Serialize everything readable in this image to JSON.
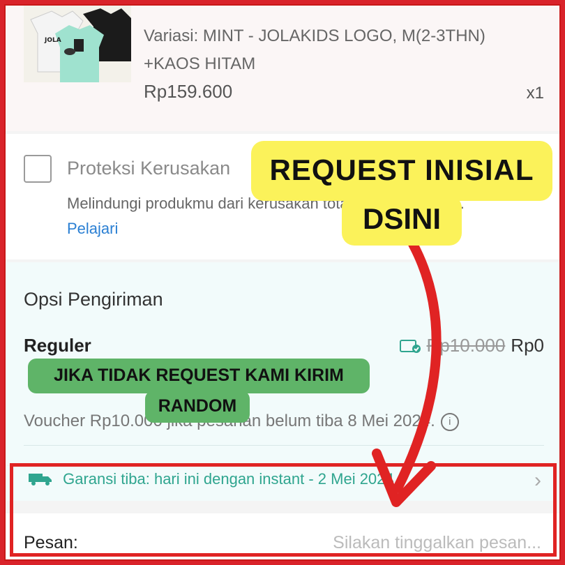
{
  "product": {
    "variant": "Variasi: MINT - JOLAKIDS LOGO, M(2-3THN) +KAOS HITAM",
    "price": "Rp159.600",
    "quantity": "x1"
  },
  "protection": {
    "title": "Proteksi Kerusakan",
    "description": "Melindungi produkmu dari kerusakan total selama 6 bulan.",
    "learn_more": "Pelajari"
  },
  "shipping": {
    "section_title": "Opsi Pengiriman",
    "method": "Reguler",
    "old_price": "Rp10.000",
    "price": "Rp0",
    "voucher_note": "Voucher Rp10.000 jika pesanan belum tiba 8 Mei 2024.",
    "guarantee": "Garansi tiba: hari ini dengan instant - 2 Mei 2024"
  },
  "message": {
    "label": "Pesan:",
    "placeholder": "Silakan tinggalkan pesan..."
  },
  "annotations": {
    "yellow_line1": "REQUEST INISIAL",
    "yellow_line2": "DSINI",
    "green_line1": "JIKA TIDAK REQUEST KAMI KIRIM",
    "green_line2": "RANDOM"
  },
  "colors": {
    "frame_red": "#d9232a",
    "callout_yellow": "#fbf25a",
    "callout_green": "#5fb468",
    "arrow_red": "#e02323",
    "link_blue": "#2a7fd3",
    "guarantee_teal": "#2fa58f"
  },
  "icons": [
    "voucher-icon",
    "info-icon",
    "truck-icon",
    "chevron-right-icon",
    "checkbox-icon"
  ]
}
